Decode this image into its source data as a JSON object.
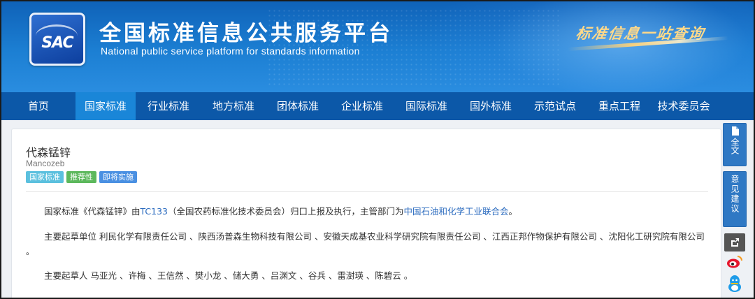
{
  "header": {
    "logo_text": "SAC",
    "title": "全国标准信息公共服务平台",
    "subtitle": "National public service platform  for standards information",
    "slogan": "标准信息一站查询"
  },
  "nav": {
    "items": [
      {
        "label": "首页"
      },
      {
        "label": "国家标准"
      },
      {
        "label": "行业标准"
      },
      {
        "label": "地方标准"
      },
      {
        "label": "团体标准"
      },
      {
        "label": "企业标准"
      },
      {
        "label": "国际标准"
      },
      {
        "label": "国外标准"
      },
      {
        "label": "示范试点"
      },
      {
        "label": "重点工程"
      },
      {
        "label": "技术委员会"
      }
    ],
    "active": "国家标准"
  },
  "standard": {
    "title": "代森锰锌",
    "title_en": "Mancozeb",
    "badges": [
      {
        "label": "国家标准",
        "color": "#5bc0de"
      },
      {
        "label": "推荐性",
        "color": "#5cb85c"
      },
      {
        "label": "即将实施",
        "color": "#4a90e2"
      }
    ],
    "desc_prefix": "国家标准《代森锰锌》由",
    "tc_code": "TC133",
    "desc_middle": "（全国农药标准化技术委员会）归口上报及执行，主管部门为",
    "authority": "中国石油和化学工业联合会",
    "desc_suffix": "。",
    "drafting_units_label": "主要起草单位",
    "drafting_units": "利民化学有限责任公司 、陕西汤普森生物科技有限公司 、安徽天成基农业科学研究院有限责任公司 、江西正邦作物保护有限公司 、沈阳化工研究院有限公司",
    "drafting_units_end": "。",
    "drafters_label": "主要起草人",
    "drafters": "马亚光 、许梅 、王信然 、樊小龙 、储大勇 、吕渊文 、谷兵 、雷澍瑛 、陈碧云 。"
  },
  "sidebar_tools": {
    "full_text_label": "全文",
    "feedback_label": "意见建议"
  },
  "colors": {
    "banner": "#1c7fd3",
    "nav_bg": "#0c58a8",
    "nav_active": "#1a86d8",
    "link": "#2b6bbf",
    "slogan": "#ffd989"
  }
}
